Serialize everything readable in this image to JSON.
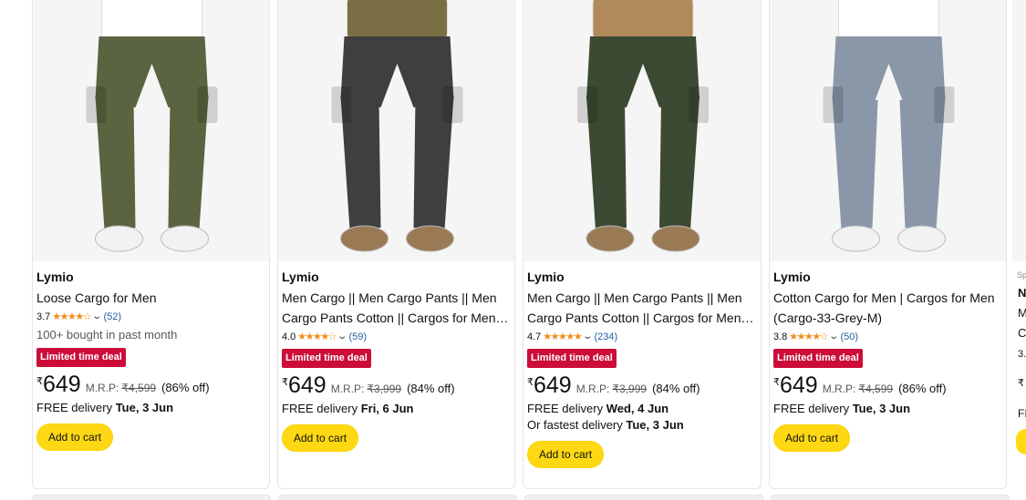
{
  "products": [
    {
      "brand": "Lymio",
      "title": "Loose Cargo for Men",
      "rating": "3.7",
      "stars": "★★★★☆",
      "review_count": "(52)",
      "bought": "100+ bought in past month",
      "deal": "Limited time deal",
      "currency": "₹",
      "price": "649",
      "mrp_label": "M.R.P:",
      "mrp": "₹4,599",
      "discount": "(86% off)",
      "delivery_prefix": "FREE delivery ",
      "delivery_date": "Tue, 3 Jun",
      "fastest_prefix": "",
      "fastest_date": "",
      "cart": "Add to cart",
      "pants_color": "#5a6440",
      "shirt_color": "#ffffff",
      "shoe_color": "#f2f2f2"
    },
    {
      "brand": "Lymio",
      "title": "Men Cargo || Men Cargo Pants || Men Cargo Pants Cotton || Cargos for Men || Cargo Pants",
      "rating": "4.0",
      "stars": "★★★★☆",
      "review_count": "(59)",
      "bought": "",
      "deal": "Limited time deal",
      "currency": "₹",
      "price": "649",
      "mrp_label": "M.R.P:",
      "mrp": "₹3,999",
      "discount": "(84% off)",
      "delivery_prefix": "FREE delivery ",
      "delivery_date": "Fri, 6 Jun",
      "fastest_prefix": "",
      "fastest_date": "",
      "cart": "Add to cart",
      "pants_color": "#3f3f3f",
      "shirt_color": "#7a6e44",
      "shoe_color": "#9a7a55"
    },
    {
      "brand": "Lymio",
      "title": "Men Cargo || Men Cargo Pants || Men Cargo Pants Cotton || Cargos for Men || Cargo Pants",
      "rating": "4.7",
      "stars": "★★★★★",
      "review_count": "(234)",
      "bought": "",
      "deal": "Limited time deal",
      "currency": "₹",
      "price": "649",
      "mrp_label": "M.R.P:",
      "mrp": "₹3,999",
      "discount": "(84% off)",
      "delivery_prefix": "FREE delivery ",
      "delivery_date": "Wed, 4 Jun",
      "fastest_prefix": "Or fastest delivery ",
      "fastest_date": "Tue, 3 Jun",
      "cart": "Add to cart",
      "pants_color": "#3d4a33",
      "shirt_color": "#b08a5a",
      "shoe_color": "#9a7a55"
    },
    {
      "brand": "Lymio",
      "title": "Cotton Cargo for Men | Cargos for Men (Cargo-33-Grey-M)",
      "rating": "3.8",
      "stars": "★★★★☆",
      "review_count": "(50)",
      "bought": "",
      "deal": "Limited time deal",
      "currency": "₹",
      "price": "649",
      "mrp_label": "M.R.P:",
      "mrp": "₹4,599",
      "discount": "(86% off)",
      "delivery_prefix": "FREE delivery ",
      "delivery_date": "Tue, 3 Jun",
      "fastest_prefix": "",
      "fastest_date": "",
      "cart": "Add to cart",
      "pants_color": "#8a97a8",
      "shirt_color": "#ffffff",
      "shoe_color": "#f2f2f2"
    }
  ],
  "edge_card": {
    "sponsored": "Sp",
    "line1": "N",
    "line2": "M",
    "line3": "C",
    "rating": "3.",
    "price": "₹",
    "delivery": "FI"
  },
  "colors": {
    "deal_red": "#cc0c39",
    "cart_yellow": "#ffd814",
    "star_orange": "#f48b1a",
    "link_blue": "#2162a1"
  }
}
